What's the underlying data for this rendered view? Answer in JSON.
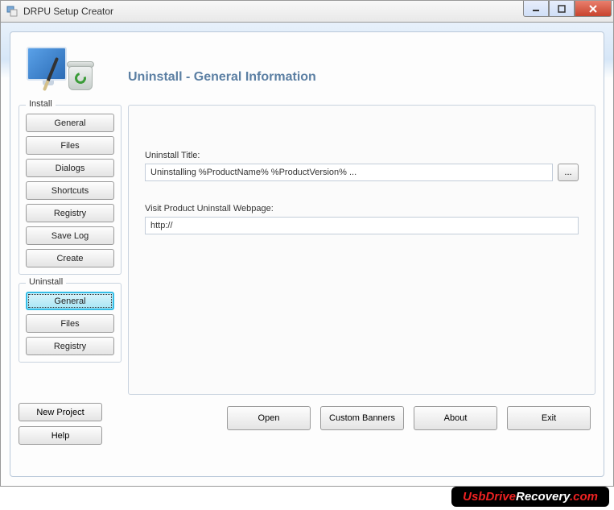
{
  "window": {
    "title": "DRPU Setup Creator"
  },
  "header": {
    "title": "Uninstall - General Information"
  },
  "sidebar": {
    "install": {
      "legend": "Install",
      "items": [
        {
          "label": "General"
        },
        {
          "label": "Files"
        },
        {
          "label": "Dialogs"
        },
        {
          "label": "Shortcuts"
        },
        {
          "label": "Registry"
        },
        {
          "label": "Save Log"
        },
        {
          "label": "Create"
        }
      ]
    },
    "uninstall": {
      "legend": "Uninstall",
      "items": [
        {
          "label": "General"
        },
        {
          "label": "Files"
        },
        {
          "label": "Registry"
        }
      ]
    }
  },
  "content": {
    "uninstall_title_label": "Uninstall Title:",
    "uninstall_title_value": "Uninstalling %ProductName% %ProductVersion% ...",
    "browse_label": "...",
    "webpage_label": "Visit Product Uninstall Webpage:",
    "webpage_value": "http://"
  },
  "bottom": {
    "new_project": "New Project",
    "help": "Help",
    "open": "Open",
    "custom_banners": "Custom Banners",
    "about": "About",
    "exit": "Exit"
  },
  "watermark": {
    "text1": "UsbDrive",
    "text2": "Recovery",
    "text3": ".com"
  }
}
